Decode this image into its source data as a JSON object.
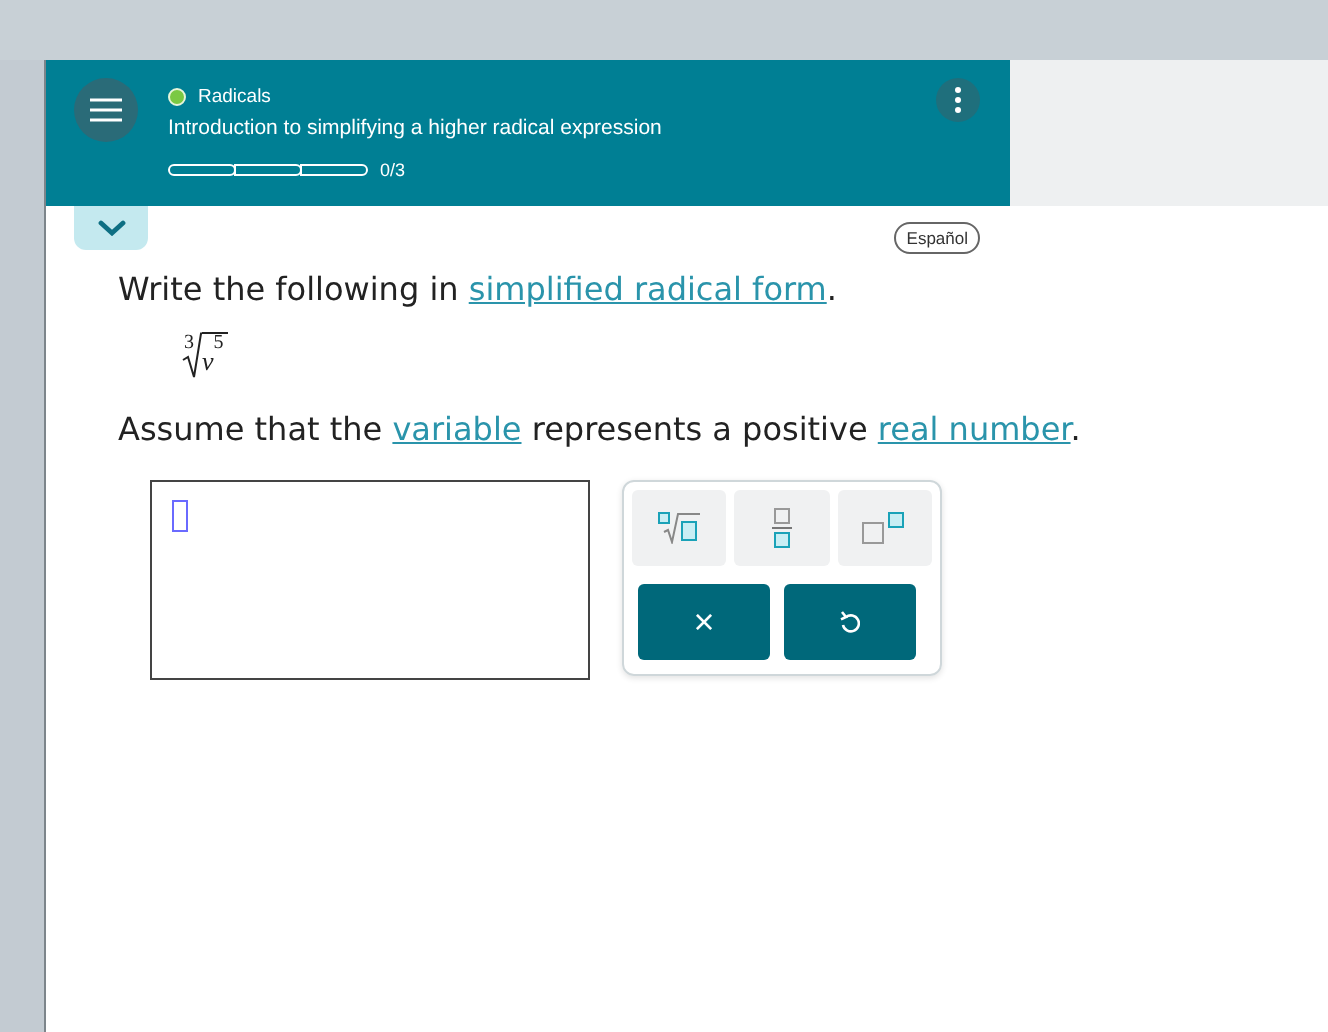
{
  "header": {
    "topic": "Radicals",
    "title": "Introduction to simplifying a higher radical expression",
    "progress": {
      "segments": [
        {
          "filled": false
        },
        {
          "filled": false
        },
        {
          "filled": false
        }
      ],
      "count": "0/3"
    }
  },
  "language_button": "Español",
  "prompt": [
    {
      "kind": "text",
      "parts": [
        {
          "kind": "plain",
          "text": "Write the following in "
        },
        {
          "kind": "link",
          "text": "simplified radical form"
        },
        {
          "kind": "plain",
          "text": "."
        }
      ]
    },
    {
      "kind": "math",
      "index": "3",
      "radicand": "v",
      "exponent": "5"
    },
    {
      "kind": "text",
      "parts": [
        {
          "kind": "plain",
          "text": "Assume that the "
        },
        {
          "kind": "link",
          "text": "variable"
        },
        {
          "kind": "plain",
          "text": " represents a positive "
        },
        {
          "kind": "link",
          "text": "real number"
        },
        {
          "kind": "plain",
          "text": "."
        }
      ]
    }
  ],
  "keypad": {
    "templates": [
      {
        "kind": "nth-root"
      },
      {
        "kind": "fraction"
      },
      {
        "kind": "power"
      }
    ],
    "actions": [
      {
        "kind": "clear",
        "label": "×"
      },
      {
        "kind": "undo"
      }
    ]
  }
}
